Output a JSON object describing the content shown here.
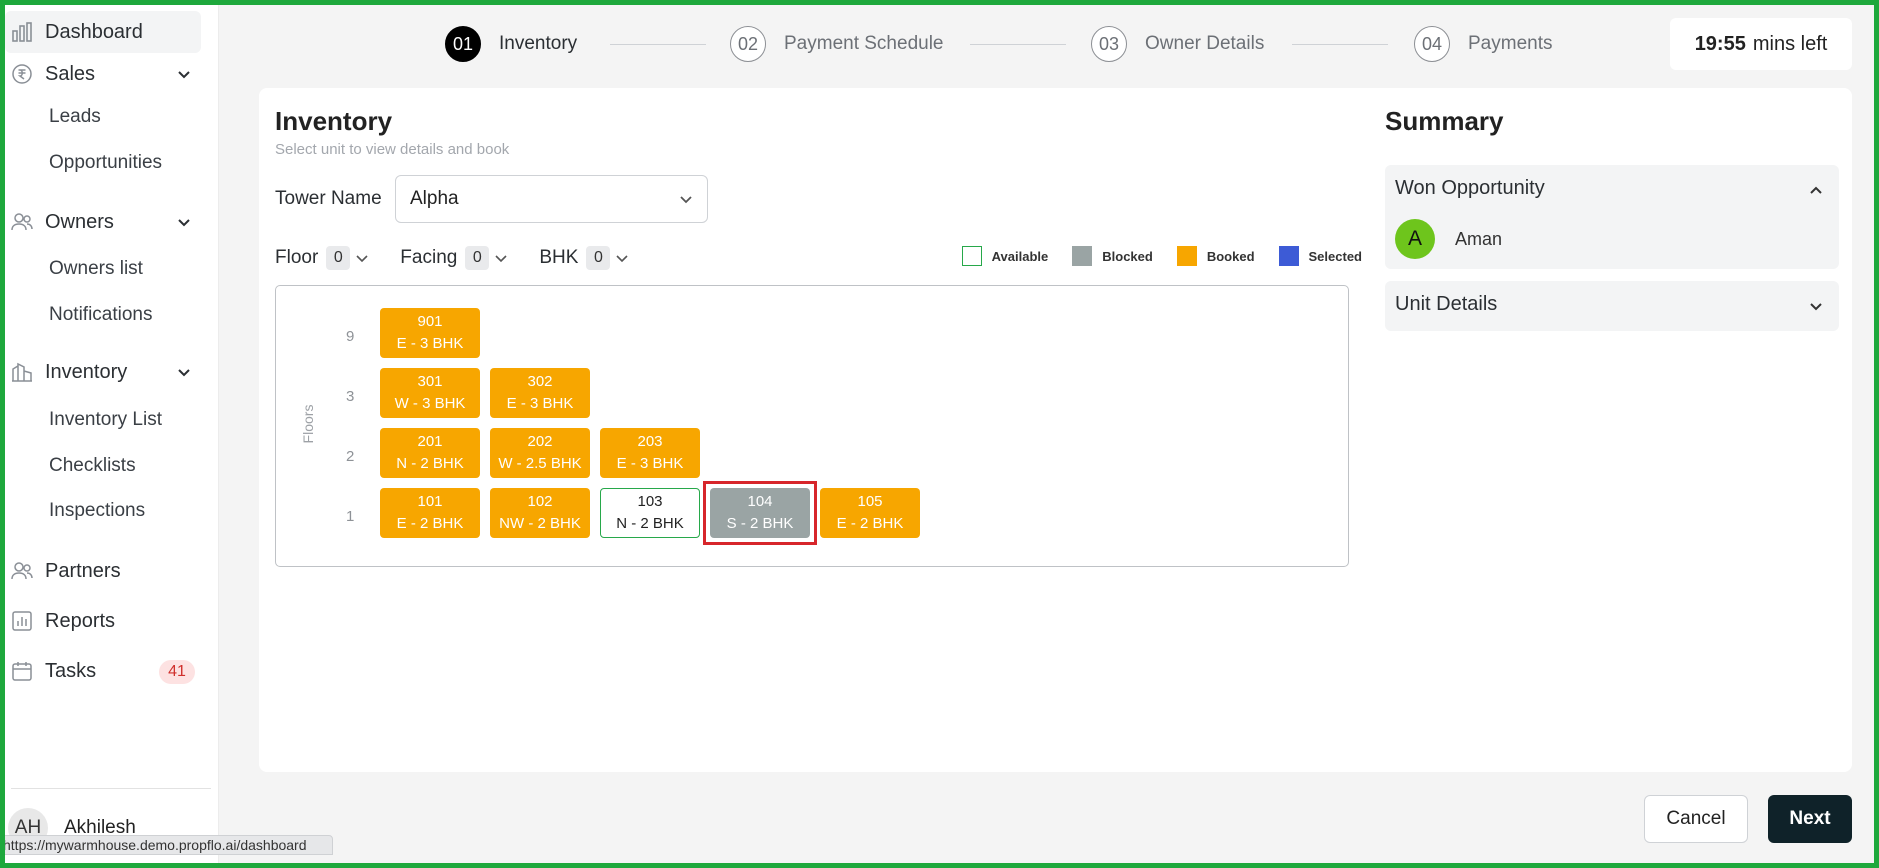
{
  "sidebar": {
    "dashboard": "Dashboard",
    "sales": "Sales",
    "leads": "Leads",
    "opportunities": "Opportunities",
    "owners": "Owners",
    "owners_list": "Owners list",
    "notifications": "Notifications",
    "inventory": "Inventory",
    "inventory_list": "Inventory List",
    "checklists": "Checklists",
    "inspections": "Inspections",
    "partners": "Partners",
    "reports": "Reports",
    "tasks": "Tasks",
    "tasks_count": "41",
    "user_initials": "AH",
    "user_name": "Akhilesh",
    "status_url": "https://mywarmhouse.demo.propflo.ai/dashboard"
  },
  "stepper": {
    "steps": [
      {
        "num": "01",
        "label": "Inventory"
      },
      {
        "num": "02",
        "label": "Payment Schedule"
      },
      {
        "num": "03",
        "label": "Owner Details"
      },
      {
        "num": "04",
        "label": "Payments"
      }
    ]
  },
  "timer": {
    "value": "19:55",
    "suffix": "mins left"
  },
  "inventory": {
    "title": "Inventory",
    "subtitle": "Select unit to view details and book",
    "tower_label": "Tower Name",
    "tower_value": "Alpha",
    "filters": [
      {
        "label": "Floor",
        "count": "0"
      },
      {
        "label": "Facing",
        "count": "0"
      },
      {
        "label": "BHK",
        "count": "0"
      }
    ],
    "legend": [
      {
        "label": "Available",
        "color": "#ffffff",
        "border": "#27a84a"
      },
      {
        "label": "Blocked",
        "color": "#9aa4a4"
      },
      {
        "label": "Booked",
        "color": "#f7a600"
      },
      {
        "label": "Selected",
        "color": "#3d5bd6"
      }
    ],
    "axis_label": "Floors",
    "floors": [
      {
        "floor": "9",
        "units": [
          {
            "no": "901",
            "desc": "E - 3 BHK",
            "status": "booked"
          }
        ]
      },
      {
        "floor": "3",
        "units": [
          {
            "no": "301",
            "desc": "W - 3 BHK",
            "status": "booked"
          },
          {
            "no": "302",
            "desc": "E - 3 BHK",
            "status": "booked"
          }
        ]
      },
      {
        "floor": "2",
        "units": [
          {
            "no": "201",
            "desc": "N - 2 BHK",
            "status": "booked"
          },
          {
            "no": "202",
            "desc": "W - 2.5 BHK",
            "status": "booked"
          },
          {
            "no": "203",
            "desc": "E - 3 BHK",
            "status": "booked"
          }
        ]
      },
      {
        "floor": "1",
        "units": [
          {
            "no": "101",
            "desc": "E - 2 BHK",
            "status": "booked"
          },
          {
            "no": "102",
            "desc": "NW - 2 BHK",
            "status": "booked"
          },
          {
            "no": "103",
            "desc": "N - 2 BHK",
            "status": "available"
          },
          {
            "no": "104",
            "desc": "S - 2 BHK",
            "status": "blocked"
          },
          {
            "no": "105",
            "desc": "E - 2 BHK",
            "status": "booked"
          }
        ]
      }
    ]
  },
  "summary": {
    "title": "Summary",
    "won_opportunity": "Won Opportunity",
    "won_initial": "A",
    "won_name": "Aman",
    "unit_details": "Unit Details"
  },
  "footer": {
    "cancel": "Cancel",
    "next": "Next"
  }
}
